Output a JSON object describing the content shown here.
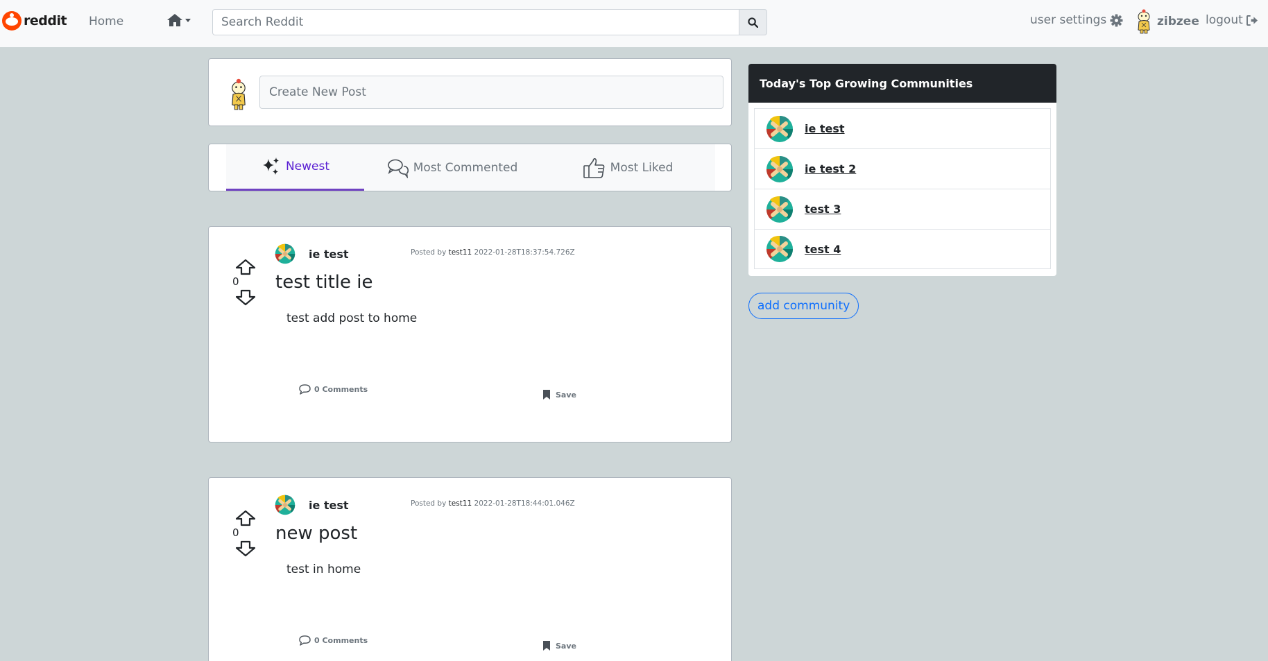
{
  "navbar": {
    "brand": "reddit",
    "home": "Home",
    "search_placeholder": "Search Reddit",
    "user_settings": "user settings",
    "username": "zibzee",
    "logout": "logout"
  },
  "create_post": {
    "placeholder": "Create New Post"
  },
  "sort_tabs": [
    {
      "label": "Newest",
      "active": true,
      "icon": "sparkles-icon"
    },
    {
      "label": "Most Commented",
      "active": false,
      "icon": "chat-bubbles-icon"
    },
    {
      "label": "Most Liked",
      "active": false,
      "icon": "thumbs-up-icon"
    }
  ],
  "posts": [
    {
      "votes": "0",
      "community": "ie test",
      "posted_by_label": "Posted by",
      "author": "test11",
      "timestamp": "2022-01-28T18:37:54.726Z",
      "title": "test title ie",
      "body": "test add post to home",
      "comments": "0 Comments",
      "save": "Save"
    },
    {
      "votes": "0",
      "community": "ie test",
      "posted_by_label": "Posted by",
      "author": "test11",
      "timestamp": "2022-01-28T18:44:01.046Z",
      "title": "new post",
      "body": "test in home",
      "comments": "0 Comments",
      "save": "Save"
    }
  ],
  "sidebar": {
    "title": "Today's Top Growing Communities",
    "communities": [
      {
        "name": "ie test"
      },
      {
        "name": "ie test 2"
      },
      {
        "name": "test 3"
      },
      {
        "name": "test 4"
      }
    ],
    "add_button": "add community"
  },
  "colors": {
    "page_bg": "#cdd6d7",
    "active_tab": "#5b20d3",
    "link_blue": "#0d6efd",
    "sidebar_header": "#212529"
  }
}
